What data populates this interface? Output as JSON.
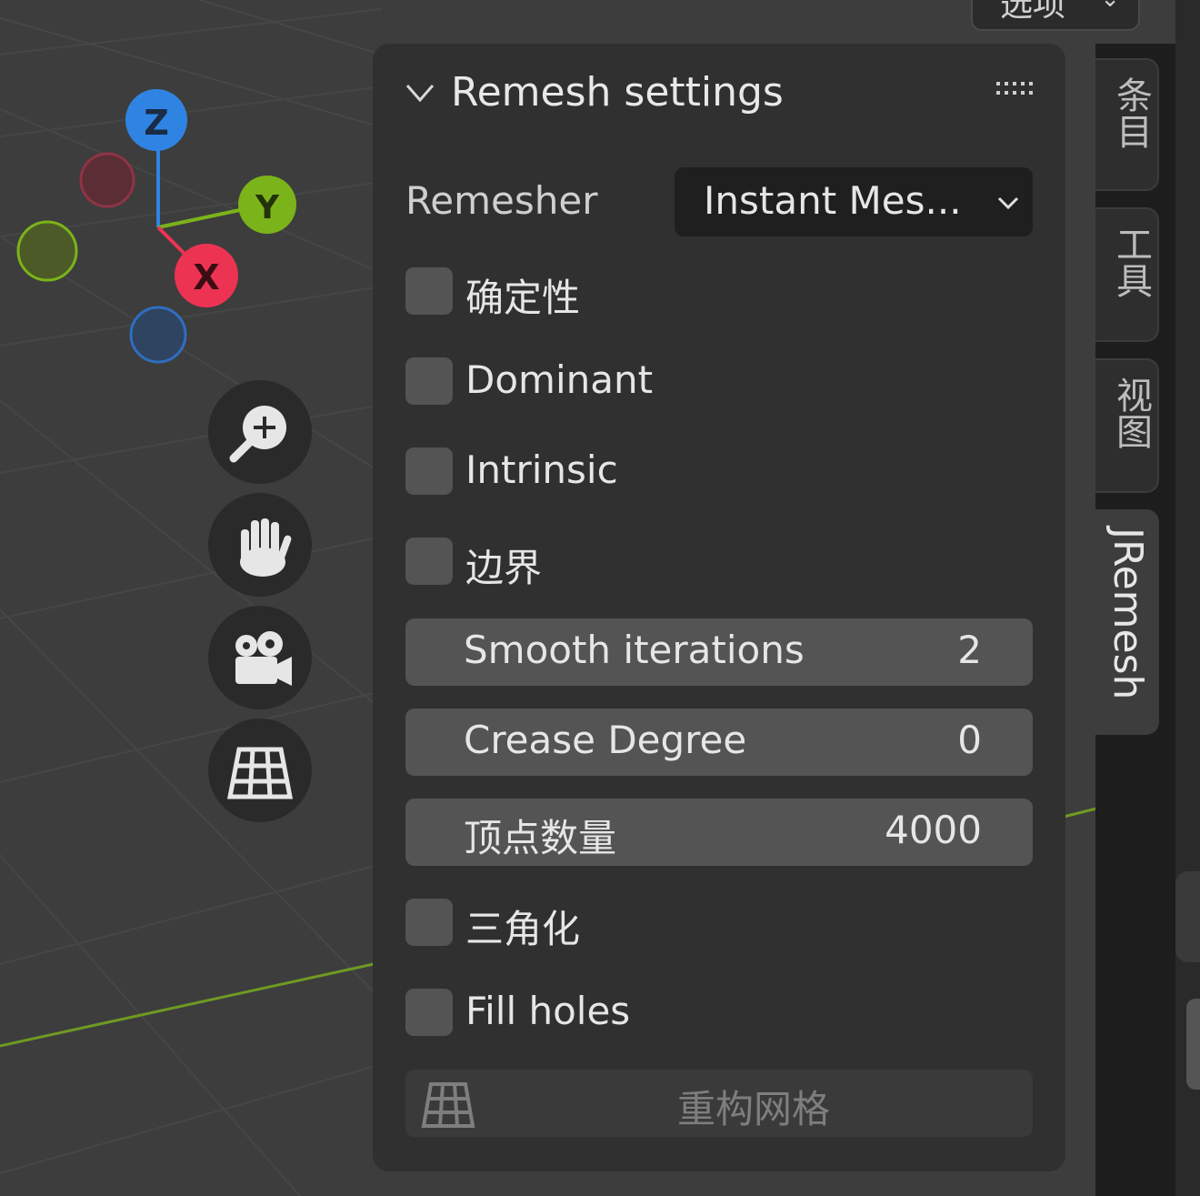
{
  "top_dropdown": {
    "label": "选项",
    "chevron": "chevron-down-icon"
  },
  "panel": {
    "title": "Remesh settings",
    "remesher": {
      "label": "Remesher",
      "value": "Instant Mes..."
    },
    "checkboxes": {
      "deterministic": {
        "label": "确定性",
        "checked": false
      },
      "dominant": {
        "label": "Dominant",
        "checked": false
      },
      "intrinsic": {
        "label": "Intrinsic",
        "checked": false
      },
      "boundary": {
        "label": "边界",
        "checked": false
      },
      "triangulate": {
        "label": "三角化",
        "checked": false
      },
      "fill_holes": {
        "label": "Fill holes",
        "checked": false
      }
    },
    "fields": {
      "smooth": {
        "label": "Smooth iterations",
        "value": "2"
      },
      "crease": {
        "label": "Crease Degree",
        "value": "0"
      },
      "vertex_count": {
        "label": "顶点数量",
        "value": "4000"
      }
    },
    "remesh_button": {
      "label": "重构网格",
      "icon": "grid-icon"
    }
  },
  "tabs": {
    "item": "条目",
    "tool": "工具",
    "view": "视图",
    "jremesh": "JRemesh"
  },
  "gizmo": {
    "x": "X",
    "y": "Y",
    "z": "Z"
  },
  "nav": [
    "zoom-icon",
    "hand-icon",
    "camera-icon",
    "grid-icon"
  ],
  "colors": {
    "x_axis": "#ed3352",
    "y_axis": "#7bb31a",
    "z_axis": "#2f84e3",
    "panel_bg": "#303030"
  }
}
